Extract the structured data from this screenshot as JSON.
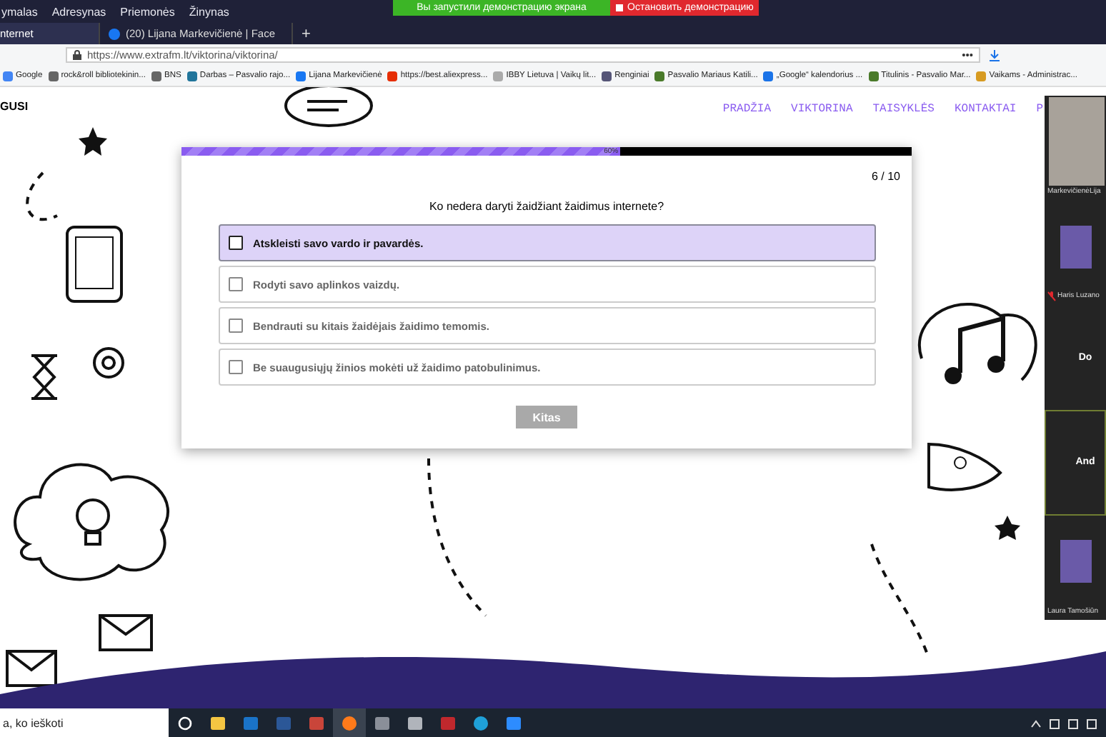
{
  "menu_bar": {
    "items": [
      "ymalas",
      "Adresynas",
      "Priemonės",
      "Žinynas"
    ]
  },
  "screen_share_banner": {
    "status": "Вы запустили демонстрацию экрана",
    "stop_button": "Остановить демонстрацию"
  },
  "tabs": [
    {
      "label": "nternet",
      "selected": true
    },
    {
      "label": "(20) Lijana Markevičienė | Face",
      "selected": false
    }
  ],
  "new_tab": "+",
  "address_bar": {
    "url": "https://www.extrafm.lt/viktorina/viktorina/",
    "menu": "•••"
  },
  "bookmarks": [
    "Google",
    "rock&roll bibliotekinin...",
    "BNS",
    "Darbas – Pasvalio rajo...",
    "Lijana Markevičienė",
    "https://best.aliexpress...",
    "IBBY Lietuva | Vaikų lit...",
    "Renginiai",
    "Pasvalio Mariaus Katili...",
    "„Google“ kalendorius ...",
    "Titulinis - Pasvalio Mar...",
    "Vaikams - Administrac..."
  ],
  "site": {
    "logo": "GUSI",
    "nav": [
      "PRADŽIA",
      "VIKTORINA",
      "TAISYKLĖS",
      "KONTAKTAI",
      "P"
    ]
  },
  "quiz": {
    "progress": {
      "level": 0.6,
      "label": "60%"
    },
    "counter": "6 / 10",
    "question": "Ko nedera daryti žaidžiant žaidimus internete?",
    "options": [
      {
        "text": "Atskleisti savo vardo ir pavardės.",
        "selected": true
      },
      {
        "text": "Rodyti savo aplinkos vaizdų.",
        "selected": false
      },
      {
        "text": "Bendrauti su kitais žaidėjais žaidimo temomis.",
        "selected": false
      },
      {
        "text": "Be suaugusiųjų žinios mokėti už žaidimo patobulinimus.",
        "selected": false
      }
    ],
    "next_button": {
      "label": "Kitas",
      "disabled": true
    }
  },
  "video_panel": {
    "participants": [
      {
        "name": "MarkevičienėLija",
        "kind": "video",
        "muted": false,
        "speaking": false
      },
      {
        "name": "Haris Luzano",
        "kind": "picture",
        "muted": true,
        "speaking": false
      },
      {
        "name": "Do",
        "kind": "name",
        "muted": false,
        "speaking": false
      },
      {
        "name": "And",
        "kind": "name",
        "muted": false,
        "speaking": true
      },
      {
        "name": "Laura Tamošiūn",
        "kind": "picture",
        "muted": false,
        "speaking": false
      }
    ]
  },
  "taskbar": {
    "search_placeholder": "a, ko ieškoti"
  }
}
